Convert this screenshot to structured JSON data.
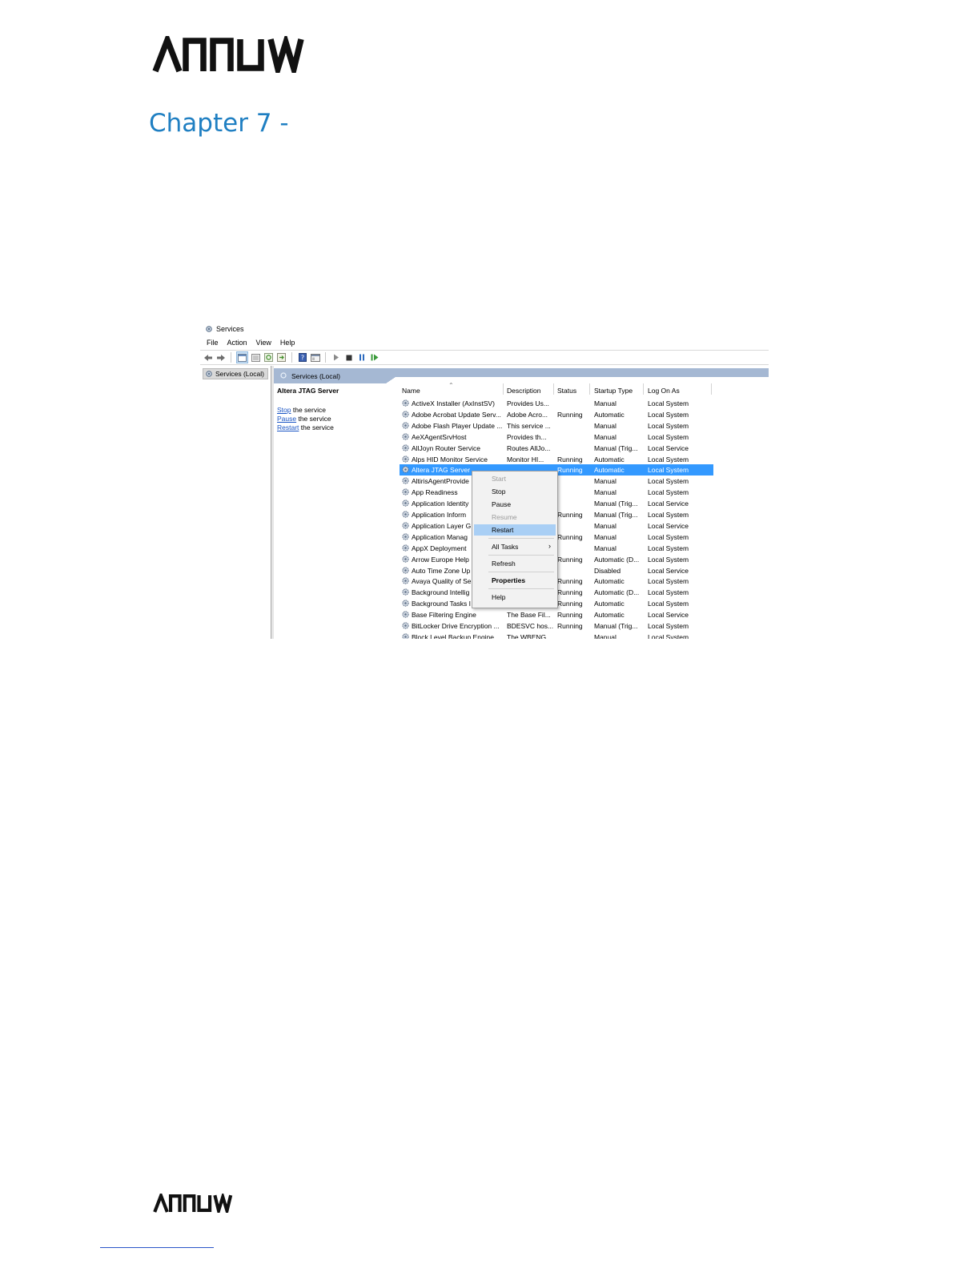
{
  "brand": {
    "name": "ARROW"
  },
  "chapter_title": "Chapter 7 -",
  "window": {
    "title": "Services",
    "menu": [
      "File",
      "Action",
      "View",
      "Help"
    ],
    "toolbar_icons": [
      "back-icon",
      "forward-icon",
      "show-hide-tree-icon",
      "properties-icon",
      "refresh-icon",
      "export-icon",
      "help-icon",
      "console-icon",
      "play-icon",
      "stop-icon",
      "pause-icon",
      "resume-icon"
    ],
    "tree_root": "Services (Local)",
    "pane_header": "Services (Local)",
    "selected_service": "Altera JTAG Server",
    "actions": [
      {
        "link": "Stop",
        "text": " the service"
      },
      {
        "link": "Pause",
        "text": " the service"
      },
      {
        "link": "Restart",
        "text": " the service"
      }
    ],
    "columns": [
      "Name",
      "Description",
      "Status",
      "Startup Type",
      "Log On As"
    ],
    "rows": [
      {
        "name": "ActiveX Installer (AxInstSV)",
        "desc": "Provides Us...",
        "status": "",
        "startup": "Manual",
        "logon": "Local System"
      },
      {
        "name": "Adobe Acrobat Update Serv...",
        "desc": "Adobe Acro...",
        "status": "Running",
        "startup": "Automatic",
        "logon": "Local System"
      },
      {
        "name": "Adobe Flash Player Update ...",
        "desc": "This service ...",
        "status": "",
        "startup": "Manual",
        "logon": "Local System"
      },
      {
        "name": "AeXAgentSrvHost",
        "desc": "Provides th...",
        "status": "",
        "startup": "Manual",
        "logon": "Local System"
      },
      {
        "name": "AllJoyn Router Service",
        "desc": "Routes AllJo...",
        "status": "",
        "startup": "Manual (Trig...",
        "logon": "Local Service"
      },
      {
        "name": "Alps HID Monitor Service",
        "desc": "Monitor HI...",
        "status": "Running",
        "startup": "Automatic",
        "logon": "Local System"
      },
      {
        "name": "Altera JTAG Server",
        "desc": "",
        "status": "Running",
        "startup": "Automatic",
        "logon": "Local System",
        "selected": true
      },
      {
        "name": "AltirisAgentProvide",
        "desc": "",
        "status": "",
        "startup": "Manual",
        "logon": "Local System"
      },
      {
        "name": "App Readiness",
        "desc": "",
        "status": "",
        "startup": "Manual",
        "logon": "Local System"
      },
      {
        "name": "Application Identity",
        "desc": "",
        "status": "",
        "startup": "Manual (Trig...",
        "logon": "Local Service"
      },
      {
        "name": "Application Inform",
        "desc": "",
        "status": "Running",
        "startup": "Manual (Trig...",
        "logon": "Local System"
      },
      {
        "name": "Application Layer G",
        "desc": "",
        "status": "",
        "startup": "Manual",
        "logon": "Local Service"
      },
      {
        "name": "Application Manag",
        "desc": "",
        "status": "Running",
        "startup": "Manual",
        "logon": "Local System"
      },
      {
        "name": "AppX Deployment",
        "desc": "",
        "status": "",
        "startup": "Manual",
        "logon": "Local System"
      },
      {
        "name": "Arrow Europe Help",
        "desc": "",
        "status": "Running",
        "startup": "Automatic (D...",
        "logon": "Local System"
      },
      {
        "name": "Auto Time Zone Up",
        "desc": "",
        "status": "",
        "startup": "Disabled",
        "logon": "Local Service"
      },
      {
        "name": "Avaya Quality of Se",
        "desc": "",
        "status": "Running",
        "startup": "Automatic",
        "logon": "Local System"
      },
      {
        "name": "Background Intellig",
        "desc": "",
        "status": "Running",
        "startup": "Automatic (D...",
        "logon": "Local System"
      },
      {
        "name": "Background Tasks I",
        "desc": "",
        "status": "Running",
        "startup": "Automatic",
        "logon": "Local System"
      },
      {
        "name": "Base Filtering Engine",
        "desc": "The Base Fil...",
        "status": "Running",
        "startup": "Automatic",
        "logon": "Local Service"
      },
      {
        "name": "BitLocker Drive Encryption ...",
        "desc": "BDESVC hos...",
        "status": "Running",
        "startup": "Manual (Trig...",
        "logon": "Local System"
      },
      {
        "name": "Block Level Backup Engine ...",
        "desc": "The WBENG...",
        "status": "",
        "startup": "Manual",
        "logon": "Local System"
      }
    ],
    "context_menu": [
      {
        "label": "Start",
        "disabled": true
      },
      {
        "label": "Stop"
      },
      {
        "label": "Pause"
      },
      {
        "label": "Resume",
        "disabled": true
      },
      {
        "label": "Restart",
        "highlighted": true
      },
      {
        "label": "All Tasks",
        "submenu": true
      },
      {
        "label": "Refresh"
      },
      {
        "label": "Properties",
        "bold": true
      },
      {
        "label": "Help"
      }
    ]
  }
}
